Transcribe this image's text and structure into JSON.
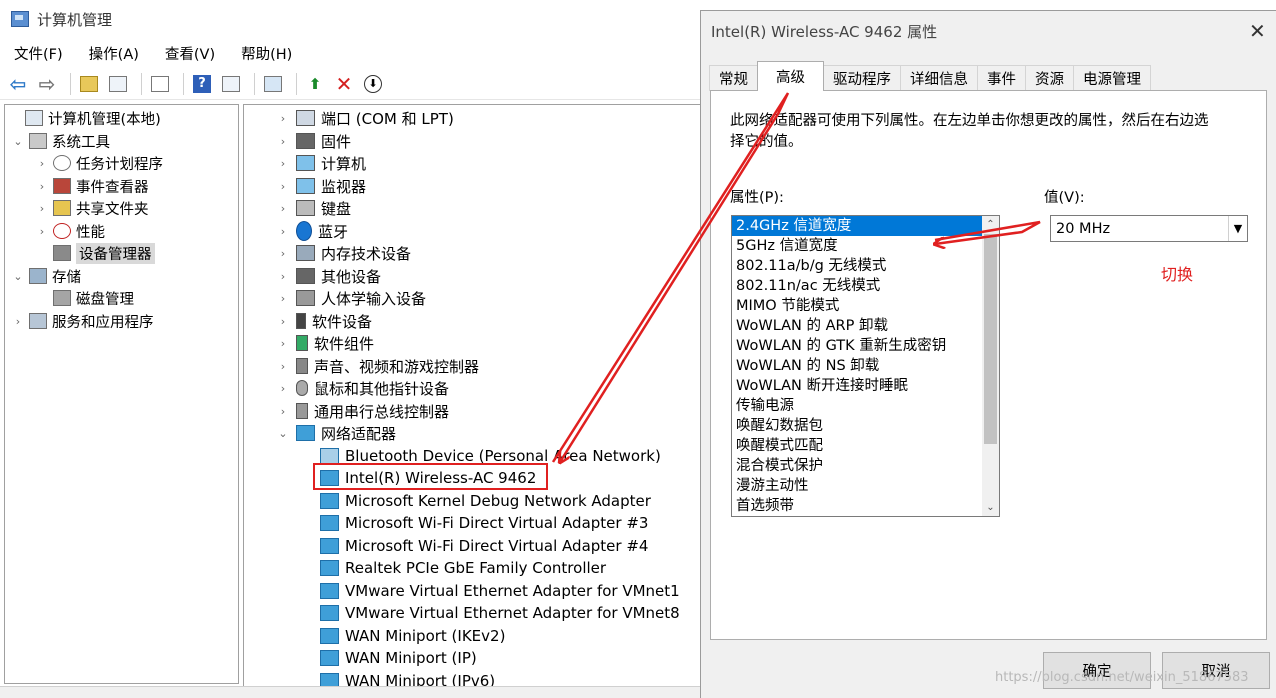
{
  "main": {
    "title": "计算机管理",
    "menu": [
      "文件(F)",
      "操作(A)",
      "查看(V)",
      "帮助(H)"
    ],
    "tree": [
      {
        "label": "计算机管理(本地)",
        "expander": ""
      },
      {
        "label": "系统工具",
        "expander": "⌄"
      },
      {
        "label": "任务计划程序",
        "expander": "›"
      },
      {
        "label": "事件查看器",
        "expander": "›"
      },
      {
        "label": "共享文件夹",
        "expander": "›"
      },
      {
        "label": "性能",
        "expander": "›"
      },
      {
        "label": "设备管理器",
        "expander": ""
      },
      {
        "label": "存储",
        "expander": "⌄"
      },
      {
        "label": "磁盘管理",
        "expander": ""
      },
      {
        "label": "服务和应用程序",
        "expander": "›"
      }
    ],
    "devices": [
      {
        "label": "端口 (COM 和 LPT)",
        "expander": "›"
      },
      {
        "label": "固件",
        "expander": "›"
      },
      {
        "label": "计算机",
        "expander": "›"
      },
      {
        "label": "监视器",
        "expander": "›"
      },
      {
        "label": "键盘",
        "expander": "›"
      },
      {
        "label": "蓝牙",
        "expander": "›"
      },
      {
        "label": "内存技术设备",
        "expander": "›"
      },
      {
        "label": "其他设备",
        "expander": "›"
      },
      {
        "label": "人体学输入设备",
        "expander": "›"
      },
      {
        "label": "软件设备",
        "expander": "›"
      },
      {
        "label": "软件组件",
        "expander": "›"
      },
      {
        "label": "声音、视频和游戏控制器",
        "expander": "›"
      },
      {
        "label": "鼠标和其他指针设备",
        "expander": "›"
      },
      {
        "label": "通用串行总线控制器",
        "expander": "›"
      },
      {
        "label": "网络适配器",
        "expander": "⌄"
      },
      {
        "label": "Bluetooth Device (Personal Area Network)",
        "expander": ""
      },
      {
        "label": "Intel(R) Wireless-AC 9462",
        "expander": ""
      },
      {
        "label": "Microsoft Kernel Debug Network Adapter",
        "expander": ""
      },
      {
        "label": "Microsoft Wi-Fi Direct Virtual Adapter #3",
        "expander": ""
      },
      {
        "label": "Microsoft Wi-Fi Direct Virtual Adapter #4",
        "expander": ""
      },
      {
        "label": "Realtek PCIe GbE Family Controller",
        "expander": ""
      },
      {
        "label": "VMware Virtual Ethernet Adapter for VMnet1",
        "expander": ""
      },
      {
        "label": "VMware Virtual Ethernet Adapter for VMnet8",
        "expander": ""
      },
      {
        "label": "WAN Miniport (IKEv2)",
        "expander": ""
      },
      {
        "label": "WAN Miniport (IP)",
        "expander": ""
      },
      {
        "label": "WAN Miniport (IPv6)",
        "expander": ""
      }
    ]
  },
  "dialog": {
    "title": "Intel(R) Wireless-AC 9462 属性",
    "close": "✕",
    "tabs": [
      "常规",
      "高级",
      "驱动程序",
      "详细信息",
      "事件",
      "资源",
      "电源管理"
    ],
    "description": "此网络适配器可使用下列属性。在左边单击你想更改的属性，然后在右边选择它的值。",
    "property_label": "属性(P):",
    "value_label": "值(V):",
    "properties": [
      "2.4GHz 信道宽度",
      "5GHz 信道宽度",
      "802.11a/b/g 无线模式",
      "802.11n/ac 无线模式",
      "MIMO 节能模式",
      "WoWLAN 的 ARP 卸载",
      "WoWLAN 的 GTK 重新生成密钥",
      "WoWLAN 的 NS 卸载",
      "WoWLAN 断开连接时睡眠",
      "传输电源",
      "唤醒幻数据包",
      "唤醒模式匹配",
      "混合模式保护",
      "漫游主动性",
      "首选频带"
    ],
    "selected_value": "20 MHz",
    "annotation": "切换",
    "ok": "确定",
    "cancel": "取消"
  },
  "watermark": "https://blog.csdn.net/weixin_51867583",
  "colors": {
    "accent": "#0078d7",
    "annotation": "#e02020"
  }
}
